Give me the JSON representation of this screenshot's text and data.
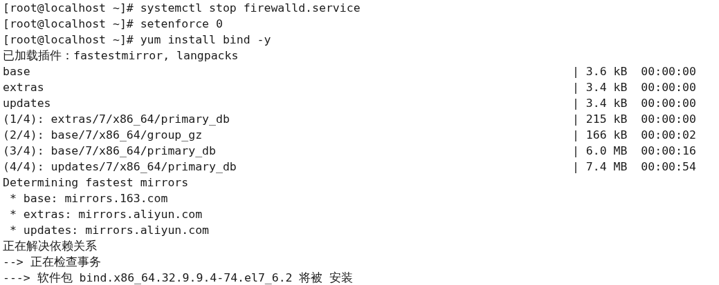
{
  "terminal": {
    "lines": [
      {
        "text": "[root@localhost ~]# systemctl stop firewalld.service"
      },
      {
        "text": "[root@localhost ~]# setenforce 0"
      },
      {
        "text": "[root@localhost ~]# yum install bind -y"
      },
      {
        "text": "已加载插件：fastestmirror, langpacks"
      },
      {
        "text": "base",
        "transfer": "| 3.6 kB  00:00:00"
      },
      {
        "text": "extras",
        "transfer": "| 3.4 kB  00:00:00"
      },
      {
        "text": "updates",
        "transfer": "| 3.4 kB  00:00:00"
      },
      {
        "text": "(1/4): extras/7/x86_64/primary_db",
        "transfer": "| 215 kB  00:00:00"
      },
      {
        "text": "(2/4): base/7/x86_64/group_gz",
        "transfer": "| 166 kB  00:00:02"
      },
      {
        "text": "(3/4): base/7/x86_64/primary_db",
        "transfer": "| 6.0 MB  00:00:16"
      },
      {
        "text": "(4/4): updates/7/x86_64/primary_db",
        "transfer": "| 7.4 MB  00:00:54"
      },
      {
        "text": "Determining fastest mirrors"
      },
      {
        "text": " * base: mirrors.163.com"
      },
      {
        "text": " * extras: mirrors.aliyun.com"
      },
      {
        "text": " * updates: mirrors.aliyun.com"
      },
      {
        "text": "正在解决依赖关系"
      },
      {
        "text": "--> 正在检查事务"
      },
      {
        "text": "---> 软件包 bind.x86_64.32.9.9.4-74.el7_6.2 将被 安装"
      }
    ]
  }
}
